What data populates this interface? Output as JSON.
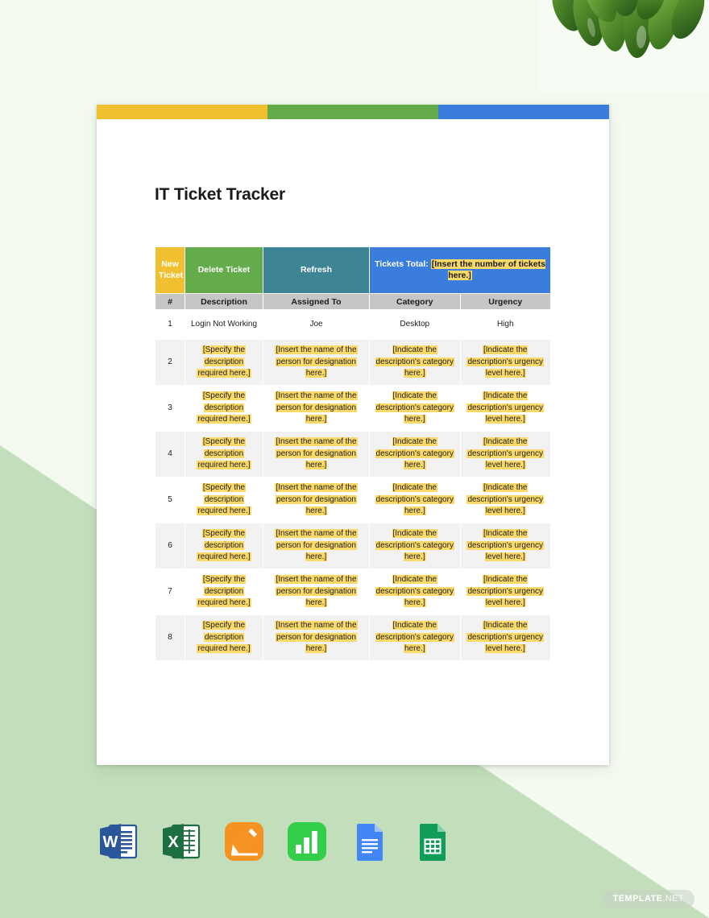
{
  "document": {
    "title": "IT Ticket Tracker",
    "color_bars": [
      {
        "name": "yellow-bar",
        "color": "#f0c030"
      },
      {
        "name": "green-bar",
        "color": "#63ab4b"
      },
      {
        "name": "blue-bar",
        "color": "#3a7ddc"
      }
    ]
  },
  "actions": {
    "new_ticket": "New Ticket",
    "delete_ticket": "Delete Ticket",
    "refresh": "Refresh",
    "tickets_total_label": "Tickets Total:",
    "tickets_total_value": "[Insert the number of tickets here.]"
  },
  "table": {
    "columns": [
      "#",
      "Description",
      "Assigned To",
      "Category",
      "Urgency"
    ],
    "rows": [
      {
        "num": "1",
        "description": "Login Not Working",
        "assigned_to": "Joe",
        "category": "Desktop",
        "urgency": "High",
        "placeholder": false
      },
      {
        "num": "2",
        "description": "[Specify the description required here.]",
        "assigned_to": "[Insert the name of the person for designation here.]",
        "category": "[Indicate the description's category here.]",
        "urgency": "[Indicate the description's urgency level here.]",
        "placeholder": true
      },
      {
        "num": "3",
        "description": "[Specify the description required here.]",
        "assigned_to": "[Insert the name of the person for designation here.]",
        "category": "[Indicate the description's category here.]",
        "urgency": "[Indicate the description's urgency level here.]",
        "placeholder": true
      },
      {
        "num": "4",
        "description": "[Specify the description required here.]",
        "assigned_to": "[Insert the name of the person for designation here.]",
        "category": "[Indicate the description's category here.]",
        "urgency": "[Indicate the description's urgency level here.]",
        "placeholder": true
      },
      {
        "num": "5",
        "description": "[Specify the description required here.]",
        "assigned_to": "[Insert the name of the person for designation here.]",
        "category": "[Indicate the description's category here.]",
        "urgency": "[Indicate the description's urgency level here.]",
        "placeholder": true
      },
      {
        "num": "6",
        "description": "[Specify the description required here.]",
        "assigned_to": "[Insert the name of the person for designation here.]",
        "category": "[Indicate the description's category here.]",
        "urgency": "[Indicate the description's urgency level here.]",
        "placeholder": true
      },
      {
        "num": "7",
        "description": "[Specify the description required here.]",
        "assigned_to": "[Insert the name of the person for designation here.]",
        "category": "[Indicate the description's category here.]",
        "urgency": "[Indicate the description's urgency level here.]",
        "placeholder": true
      },
      {
        "num": "8",
        "description": "[Specify the description required here.]",
        "assigned_to": "[Insert the name of the person for designation here.]",
        "category": "[Indicate the description's category here.]",
        "urgency": "[Indicate the description's urgency level here.]",
        "placeholder": true
      }
    ]
  },
  "app_icons": [
    {
      "name": "microsoft-word-icon",
      "label": "W"
    },
    {
      "name": "microsoft-excel-icon",
      "label": "X"
    },
    {
      "name": "apple-pages-icon",
      "label": ""
    },
    {
      "name": "apple-numbers-icon",
      "label": ""
    },
    {
      "name": "google-docs-icon",
      "label": ""
    },
    {
      "name": "google-sheets-icon",
      "label": ""
    }
  ],
  "watermark": {
    "brand": "TEMPLATE",
    "tld": ".NET"
  }
}
